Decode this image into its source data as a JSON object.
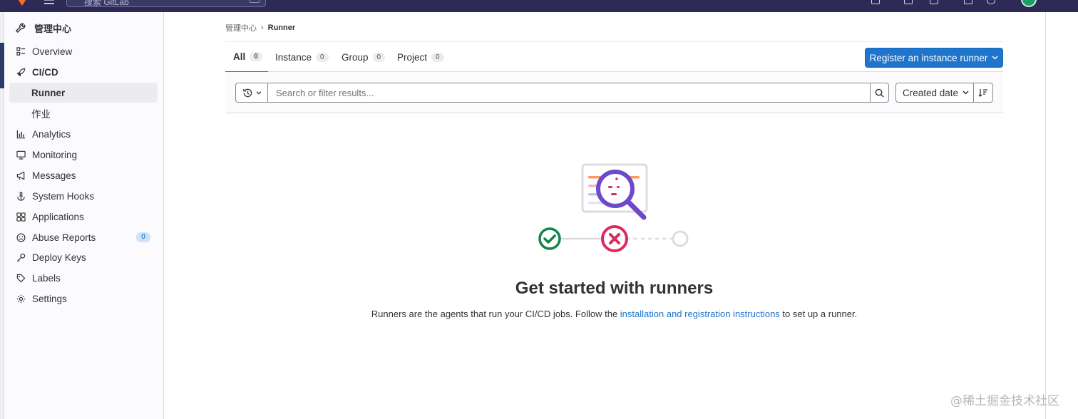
{
  "topbar": {
    "search_placeholder": "搜索 GitLab"
  },
  "sidebar": {
    "header": "管理中心",
    "items": [
      {
        "label": "Overview",
        "icon": "overview-icon"
      },
      {
        "label": "CI/CD",
        "icon": "rocket-icon"
      },
      {
        "label": "Runner"
      },
      {
        "label": "作业"
      },
      {
        "label": "Analytics",
        "icon": "chart-icon"
      },
      {
        "label": "Monitoring",
        "icon": "monitor-icon"
      },
      {
        "label": "Messages",
        "icon": "bullhorn-icon"
      },
      {
        "label": "System Hooks",
        "icon": "anchor-icon"
      },
      {
        "label": "Applications",
        "icon": "applications-icon"
      },
      {
        "label": "Abuse Reports",
        "icon": "abuse-icon",
        "badge": "0"
      },
      {
        "label": "Deploy Keys",
        "icon": "key-icon"
      },
      {
        "label": "Labels",
        "icon": "label-icon"
      },
      {
        "label": "Settings",
        "icon": "settings-icon"
      }
    ]
  },
  "breadcrumb": {
    "parent": "管理中心",
    "separator": "›",
    "current": "Runner"
  },
  "tabs": [
    {
      "label": "All",
      "count": "0"
    },
    {
      "label": "Instance",
      "count": "0"
    },
    {
      "label": "Group",
      "count": "0"
    },
    {
      "label": "Project",
      "count": "0"
    }
  ],
  "register_button": {
    "label": "Register an instance runner"
  },
  "filter": {
    "search_placeholder": "Search or filter results...",
    "sort_label": "Created date"
  },
  "empty_state": {
    "title": "Get started with runners",
    "desc_before": "Runners are the agents that run your CI/CD jobs. Follow the ",
    "link_text": "installation and registration instructions",
    "desc_after": " to set up a runner."
  },
  "watermark": "@稀土掘金技术社区",
  "colors": {
    "accent": "#1f75cb",
    "tab_active": "#6e49cb",
    "topbar": "#2d2b55",
    "success": "#108548",
    "danger": "#dd2b5c"
  }
}
